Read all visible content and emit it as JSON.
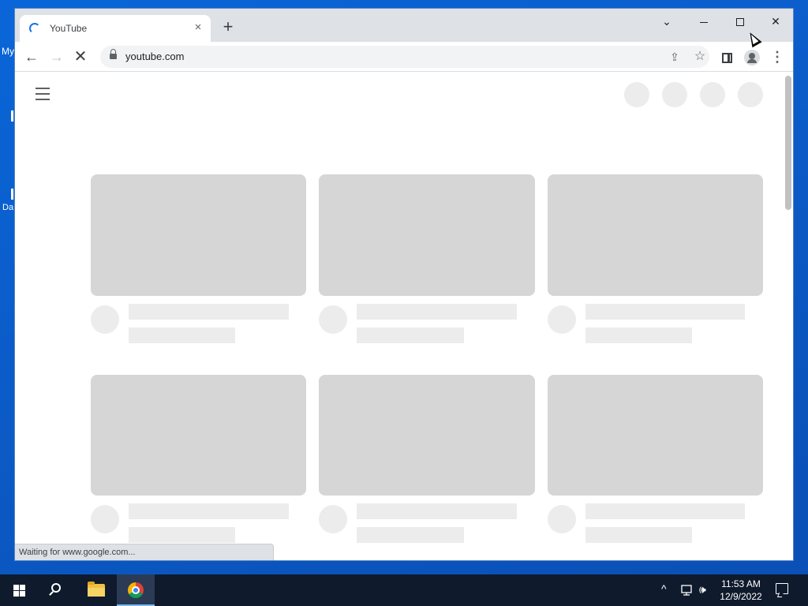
{
  "desktop": {
    "icon1_label": "My",
    "icon2_label": "Da"
  },
  "browser": {
    "tab": {
      "title": "YouTube",
      "close_glyph": "×"
    },
    "new_tab_glyph": "+",
    "window_controls": {
      "search_glyph": "⌄",
      "close_glyph": "✕"
    },
    "toolbar": {
      "back_glyph": "←",
      "forward_glyph": "→",
      "stop_glyph": "✕",
      "url": "youtube.com",
      "share_glyph": "⇪",
      "star_glyph": "☆",
      "menu_glyph": "⋮"
    },
    "status_text": "Waiting for www.google.com..."
  },
  "taskbar": {
    "tray_chevron": "^",
    "volume_glyph": "🕪",
    "time": "11:53 AM",
    "date": "12/9/2022"
  },
  "icons": {
    "tab_loading": "loading-spinner-icon",
    "lock": "lock-icon",
    "profile": "profile-icon"
  }
}
